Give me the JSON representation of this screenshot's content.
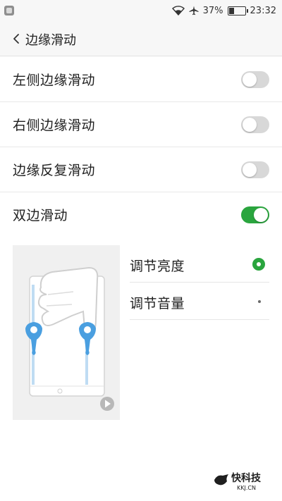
{
  "status_bar": {
    "battery_percent": "37%",
    "time": "23:32",
    "icons": [
      "notification-app-icon",
      "wifi-icon",
      "airplane-icon",
      "battery-icon"
    ]
  },
  "header": {
    "title": "边缘滑动"
  },
  "settings": [
    {
      "label": "左侧边缘滑动",
      "enabled": false
    },
    {
      "label": "右侧边缘滑动",
      "enabled": false
    },
    {
      "label": "边缘反复滑动",
      "enabled": false
    },
    {
      "label": "双边滑动",
      "enabled": true
    }
  ],
  "double_side_options": {
    "options": [
      {
        "label": "调节亮度",
        "selected": true
      },
      {
        "label": "调节音量",
        "selected": false
      }
    ]
  },
  "watermark": {
    "line1": "快科技",
    "line2": "KKJ.CN"
  },
  "colors": {
    "accent": "#2aa53e",
    "toggle_off": "#d8d8d8",
    "illustration_blue": "#4a9fe0"
  }
}
